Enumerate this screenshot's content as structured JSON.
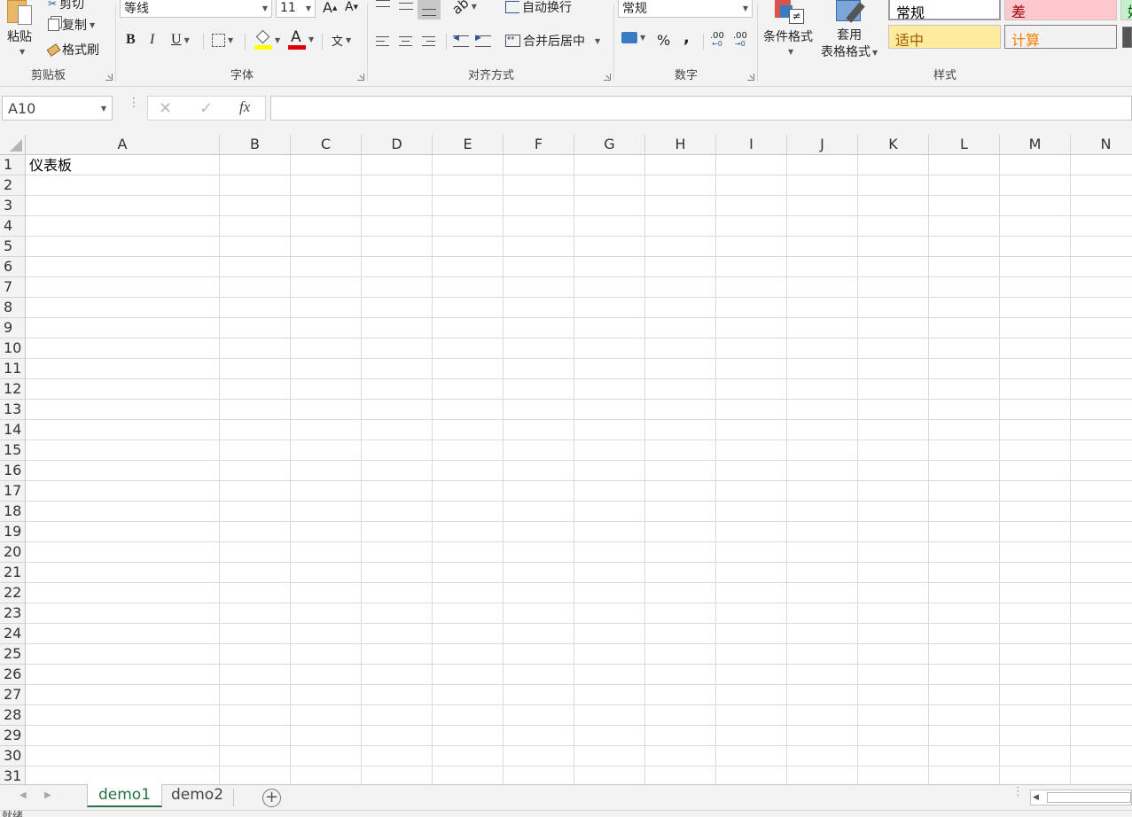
{
  "ribbon": {
    "clipboard": {
      "paste_label": "粘贴",
      "cut_label": "剪切",
      "copy_label": "复制",
      "format_painter_label": "格式刷",
      "group_label": "剪贴板"
    },
    "font": {
      "font_name": "等线",
      "font_size": "11",
      "grow_label": "A",
      "shrink_label": "A",
      "bold_label": "B",
      "italic_label": "I",
      "underline_label": "U",
      "font_color_label": "A",
      "phonetic_label": "文",
      "fill_color": "#ffff00",
      "font_color": "#e00000",
      "group_label": "字体"
    },
    "alignment": {
      "wrap_text_label": "自动换行",
      "merge_center_label": "合并后居中",
      "group_label": "对齐方式"
    },
    "number": {
      "format_value": "常规",
      "percent_label": "%",
      "comma_label": ",",
      "increase_decimal_label": ".00",
      "decrease_decimal_label": ".00",
      "group_label": "数字"
    },
    "styles": {
      "conditional_format_label": "条件格式",
      "table_format_label_1": "套用",
      "table_format_label_2": "表格格式",
      "style_normal": "常规",
      "style_bad": "差",
      "style_neutral": "适中",
      "style_calc": "计算",
      "style_good": "好",
      "group_label": "样式"
    }
  },
  "formula_bar": {
    "name_box": "A10",
    "fx_label": "fx",
    "cancel_label": "✕",
    "enter_label": "✓",
    "formula_value": ""
  },
  "grid": {
    "columns": [
      "A",
      "B",
      "C",
      "D",
      "E",
      "F",
      "G",
      "H",
      "I",
      "J",
      "K",
      "L",
      "M",
      "N"
    ],
    "rows": [
      "1",
      "2",
      "3",
      "4",
      "5",
      "6",
      "7",
      "8",
      "9",
      "10",
      "11",
      "12",
      "13",
      "14",
      "15",
      "16",
      "17",
      "18",
      "19",
      "20",
      "21",
      "22",
      "23",
      "24",
      "25",
      "26",
      "27",
      "28",
      "29",
      "30",
      "31"
    ],
    "cell_a1": "仪表板"
  },
  "sheets": {
    "tabs": [
      "demo1",
      "demo2"
    ],
    "active": "demo1",
    "add_label": "+"
  },
  "status": {
    "text": "就绪"
  }
}
